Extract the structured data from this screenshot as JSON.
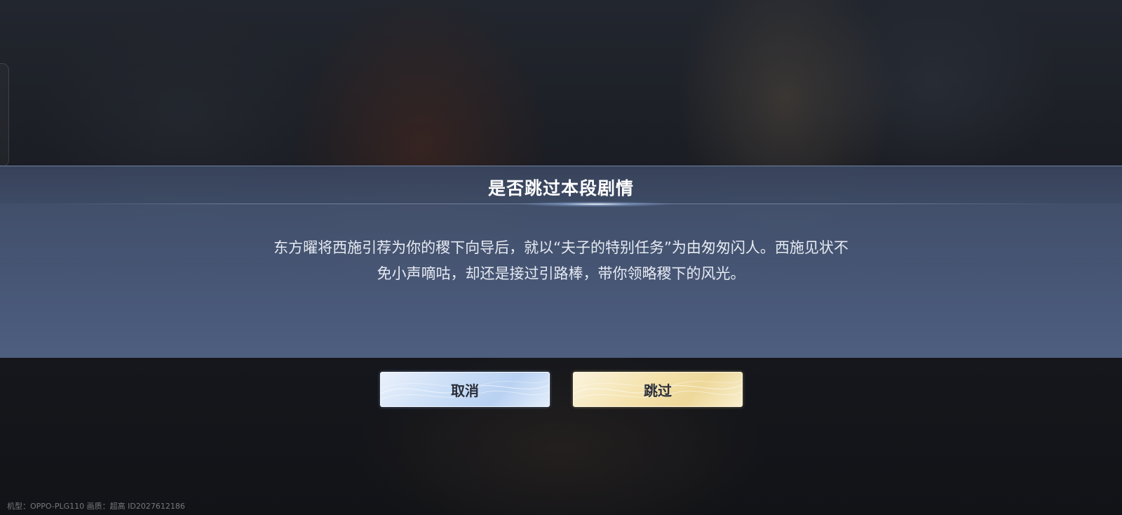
{
  "dialog": {
    "title": "是否跳过本段剧情",
    "message_line1": "东方曜将西施引荐为你的稷下向导后，就以“夫子的特别任务”为由匆匆闪人。西施见状不",
    "message_line2": "免小声嘀咕，却还是接过引路棒，带你领略稷下的风光。"
  },
  "buttons": {
    "cancel_label": "取消",
    "skip_label": "跳过"
  },
  "footer": {
    "device_info": "机型：OPPO-PLG110 画质：超高 ID2027612186"
  },
  "colors": {
    "dialog_band": "#4a5a7a",
    "cancel_button": "#c7dcf6",
    "skip_button": "#f4e2ab",
    "title_text": "#ffffff",
    "message_text": "#e6eaf2"
  }
}
